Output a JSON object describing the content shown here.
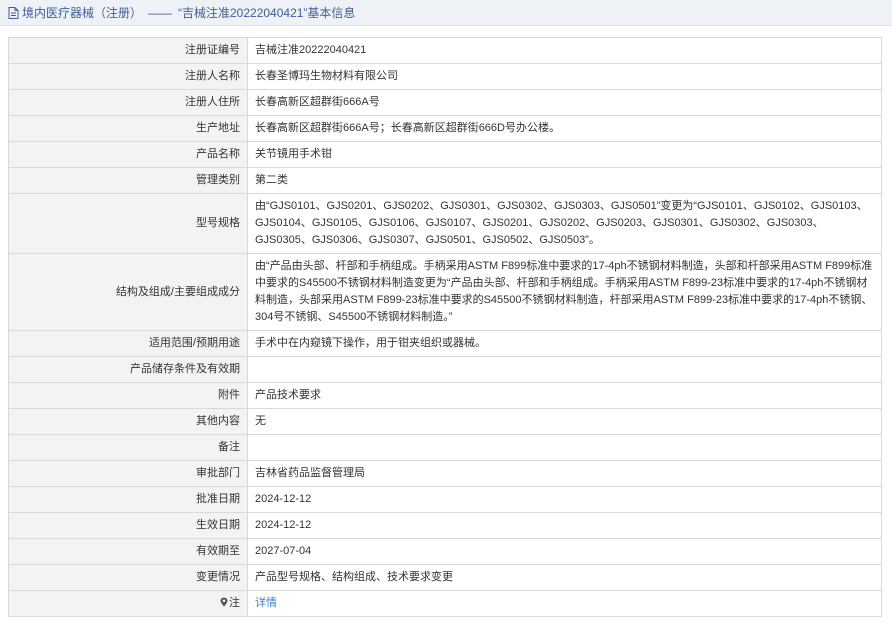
{
  "header": {
    "section": "境内医疗器械（注册）",
    "separator": "——",
    "title": "“吉械注准20222040421”基本信息"
  },
  "rows": [
    {
      "label": "注册证编号",
      "value": "吉械注准20222040421"
    },
    {
      "label": "注册人名称",
      "value": "长春圣博玛生物材料有限公司"
    },
    {
      "label": "注册人住所",
      "value": "长春高新区超群街666A号"
    },
    {
      "label": "生产地址",
      "value": "长春高新区超群街666A号；长春高新区超群街666D号办公楼。"
    },
    {
      "label": "产品名称",
      "value": "关节镜用手术钳"
    },
    {
      "label": "管理类别",
      "value": "第二类"
    },
    {
      "label": "型号规格",
      "value": "由“GJS0101、GJS0201、GJS0202、GJS0301、GJS0302、GJS0303、GJS0501”变更为“GJS0101、GJS0102、GJS0103、GJS0104、GJS0105、GJS0106、GJS0107、GJS0201、GJS0202、GJS0203、GJS0301、GJS0302、GJS0303、GJS0305、GJS0306、GJS0307、GJS0501、GJS0502、GJS0503”。"
    },
    {
      "label": "结构及组成/主要组成成分",
      "value": "由“产品由头部、杆部和手柄组成。手柄采用ASTM F899标准中要求的17-4ph不锈钢材料制造，头部和杆部采用ASTM F899标准中要求的S45500不锈钢材料制造变更为“产品由头部、杆部和手柄组成。手柄采用ASTM F899-23标准中要求的17-4ph不锈钢材料制造，头部采用ASTM F899-23标准中要求的S45500不锈钢材料制造，杆部采用ASTM F899-23标准中要求的17-4ph不锈钢、304号不锈钢、S45500不锈钢材料制造。”"
    },
    {
      "label": "适用范围/预期用途",
      "value": "手术中在内窥镜下操作，用于钳夹组织或器械。"
    },
    {
      "label": "产品储存条件及有效期",
      "value": ""
    },
    {
      "label": "附件",
      "value": "产品技术要求"
    },
    {
      "label": "其他内容",
      "value": "无"
    },
    {
      "label": "备注",
      "value": ""
    },
    {
      "label": "审批部门",
      "value": "吉林省药品监督管理局"
    },
    {
      "label": "批准日期",
      "value": "2024-12-12"
    },
    {
      "label": "生效日期",
      "value": "2024-12-12"
    },
    {
      "label": "有效期至",
      "value": "2027-07-04"
    },
    {
      "label": "变更情况",
      "value": "产品型号规格、结构组成、技术要求变更"
    }
  ],
  "note_row": {
    "label": "注",
    "link": "详情",
    "icon": "pin-icon"
  },
  "colors": {
    "header_bg": "#eef1f6",
    "header_text": "#3f5f96",
    "label_bg": "#f3f3f3",
    "border": "#d9d9d9",
    "link": "#3b7fd1"
  }
}
